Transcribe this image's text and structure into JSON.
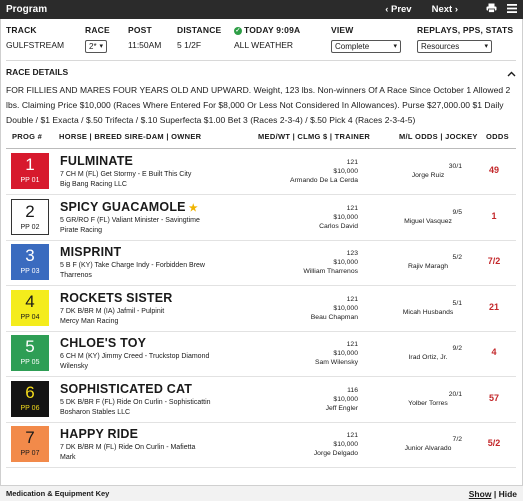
{
  "toolbar": {
    "title": "Program",
    "prev": "‹ Prev",
    "next": "Next ›",
    "print_icon": "print-icon",
    "menu_icon": "hamburger-menu-icon"
  },
  "race_info": {
    "track_label": "TRACK",
    "track_value": "GULFSTREAM",
    "race_label": "RACE",
    "race_value": "2*",
    "post_label": "POST",
    "post_value": "11:50AM",
    "distance_label": "DISTANCE",
    "distance_value": "5 1/2F",
    "today_label": "TODAY 9:09A",
    "surface_value": "ALL WEATHER",
    "view_label": "VIEW",
    "view_value": "Complete",
    "replays_label": "REPLAYS, PPS, STATS",
    "replays_value": "Resources"
  },
  "race_details": {
    "heading": "RACE DETAILS",
    "text": "FOR FILLIES AND MARES FOUR YEARS OLD AND UPWARD. Weight, 123 lbs. Non-winners Of A Race Since October 1 Allowed 2 lbs. Claiming Price $10,000 (Races Where Entered For $8,000 Or Less Not Considered In Allowances). Purse $27,000.00 $1 Daily Double / $1 Exacta / $.50 Trifecta / $.10 Superfecta $1.00 Bet 3 (Races 2-3-4) / $.50 Pick 4 (Races 2-3-4-5)"
  },
  "table": {
    "col_prog": "PROG #",
    "col_horse": "HORSE | BREED SIRE-DAM | OWNER",
    "col_med": "MED/WT | CLMG $ | TRAINER",
    "col_ml": "M/L ODDS | JOCKEY",
    "col_odds": "ODDS"
  },
  "entries": [
    {
      "num": "1",
      "pp": "PP 01",
      "bg": "#d7192d",
      "fg": "#ffffff",
      "name": "FULMINATE",
      "star": "",
      "breed": "7 CH M (FL) Get Stormy - E Built This City",
      "owner": "Big Bang Racing LLC",
      "wt": "121",
      "clm": "$10,000",
      "trainer": "Armando De La Cerda",
      "ml": "30/1",
      "jockey": "Jorge Ruiz",
      "odds": "49"
    },
    {
      "num": "2",
      "pp": "PP 02",
      "bg": "#ffffff",
      "fg": "#1a1a1a",
      "name": "SPICY GUACAMOLE",
      "star": "★",
      "breed": "5 GR/RO F (FL) Valiant Minister - Savingtime",
      "owner": "Pirate Racing",
      "wt": "121",
      "clm": "$10,000",
      "trainer": "Carlos David",
      "ml": "9/5",
      "jockey": "Miguel Vasquez",
      "odds": "1"
    },
    {
      "num": "3",
      "pp": "PP 03",
      "bg": "#3a6bbf",
      "fg": "#ffffff",
      "name": "MISPRINT",
      "star": "",
      "breed": "5 B F (KY) Take Charge Indy - Forbidden Brew",
      "owner": "Tharrenos",
      "wt": "123",
      "clm": "$10,000",
      "trainer": "William Tharrenos",
      "ml": "5/2",
      "jockey": "Rajiv Maragh",
      "odds": "7/2"
    },
    {
      "num": "4",
      "pp": "PP 04",
      "bg": "#f4ec1c",
      "fg": "#1a1a1a",
      "name": "ROCKETS SISTER",
      "star": "",
      "breed": "7 DK B/BR M (IA) Jafmil - Pulpinit",
      "owner": "Mercy Man Racing",
      "wt": "121",
      "clm": "$10,000",
      "trainer": "Beau Chapman",
      "ml": "5/1",
      "jockey": "Micah Husbands",
      "odds": "21"
    },
    {
      "num": "5",
      "pp": "PP 05",
      "bg": "#2e9e55",
      "fg": "#ffffff",
      "name": "CHLOE'S TOY",
      "star": "",
      "breed": "6 CH M (KY) Jimmy Creed - Truckstop Diamond",
      "owner": "Wilensky",
      "wt": "121",
      "clm": "$10,000",
      "trainer": "Sam Wilensky",
      "ml": "9/2",
      "jockey": "Irad Ortiz, Jr.",
      "odds": "4"
    },
    {
      "num": "6",
      "pp": "PP 06",
      "bg": "#141414",
      "fg": "#f4dc1c",
      "name": "SOPHISTICATED CAT",
      "star": "",
      "breed": "5 DK B/BR F (FL) Ride On Curlin - Sophisticattin",
      "owner": "Bosharon Stables LLC",
      "wt": "116",
      "clm": "$10,000",
      "trainer": "Jeff Engler",
      "ml": "20/1",
      "jockey": "Yolber Torres",
      "odds": "57"
    },
    {
      "num": "7",
      "pp": "PP 07",
      "bg": "#f28a4a",
      "fg": "#1a1a1a",
      "name": "HAPPY RIDE",
      "star": "",
      "breed": "7 DK B/BR M (FL) Ride On Curlin - Mafietta",
      "owner": "Mark",
      "wt": "121",
      "clm": "$10,000",
      "trainer": "Jorge Delgado",
      "ml": "7/2",
      "jockey": "Junior Alvarado",
      "odds": "5/2"
    }
  ],
  "footer": {
    "title": "Medication & Equipment Key",
    "show": "Show",
    "sep": "|",
    "hide": "Hide"
  }
}
